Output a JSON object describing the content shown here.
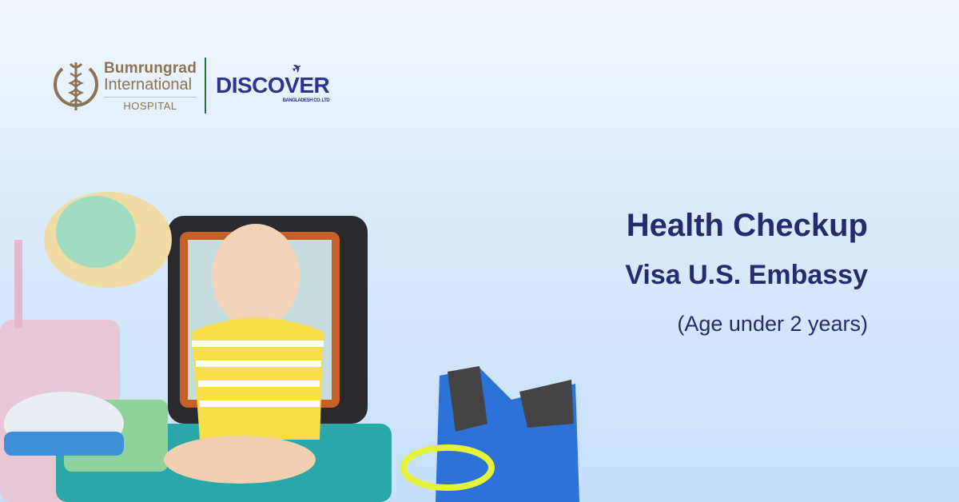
{
  "logos": {
    "hospital_line1": "Bumrungrad",
    "hospital_line2": "International",
    "hospital_line3": "HOSPITAL",
    "partner_name": "DISCOVER",
    "partner_sub": "BANGLADESH CO. LTD"
  },
  "headline": {
    "title": "Health Checkup",
    "subtitle": "Visa U.S. Embassy",
    "note": "(Age under 2 years)"
  },
  "colors": {
    "headline": "#282a6e",
    "hospital": "#8b7453",
    "partner": "#2a3590"
  }
}
